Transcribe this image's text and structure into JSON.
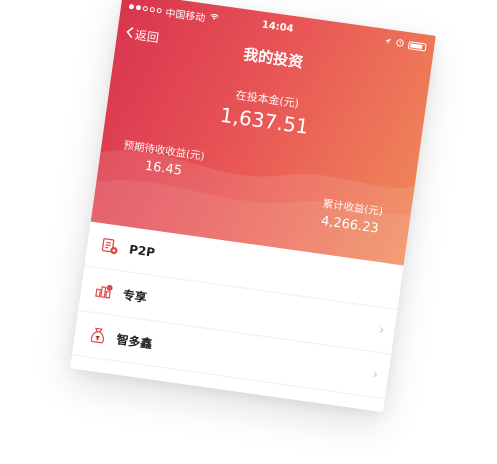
{
  "status_bar": {
    "carrier": "中国移动",
    "time": "14:04"
  },
  "nav": {
    "back_label": "返回",
    "title": "我的投资"
  },
  "summary": {
    "principal_label": "在投本金(元)",
    "principal_value": "1,637.51",
    "expected_label": "预期待收收益(元)",
    "expected_value": "16.45",
    "total_label": "累计收益(元)",
    "total_value": "4,266.23"
  },
  "menu": [
    {
      "label": "P2P",
      "icon": "p2p-icon"
    },
    {
      "label": "专享",
      "icon": "exclusive-icon"
    },
    {
      "label": "智多鑫",
      "icon": "money-bag-icon"
    }
  ],
  "colors": {
    "header_start": "#d8344e",
    "header_end": "#f08a5a",
    "icon_red": "#e24a4a"
  }
}
